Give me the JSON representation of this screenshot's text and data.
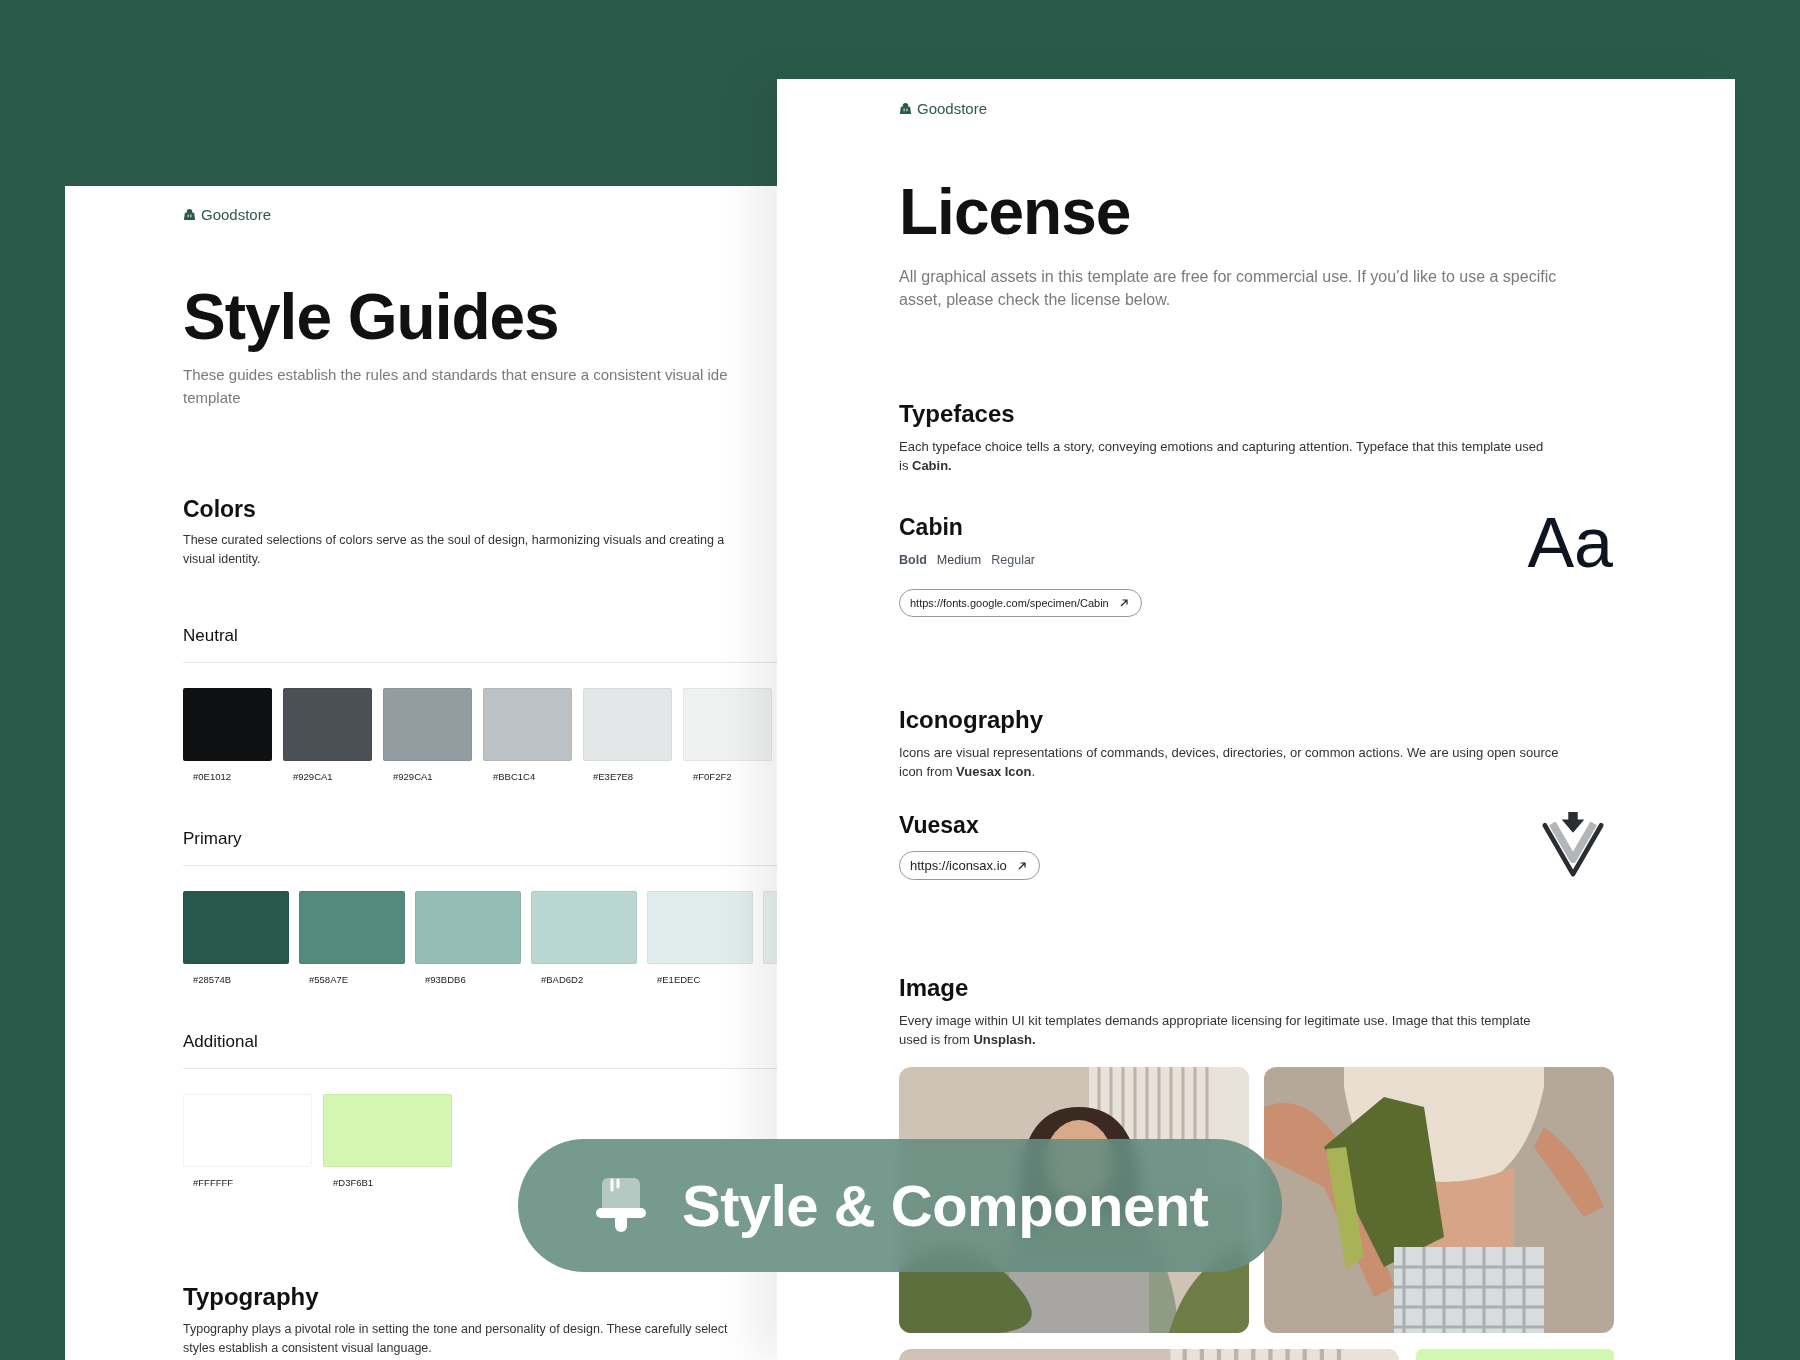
{
  "left_page": {
    "brand": "Goodstore",
    "title": "Style Guides",
    "intro_lines": [
      "These guides establish the rules and standards that ensure a consistent visual ide",
      "template"
    ],
    "colors": {
      "heading": "Colors",
      "lines": [
        "These curated selections of colors serve as the soul of design, harmonizing visuals and creating a",
        "visual identity."
      ],
      "groups": [
        {
          "title": "Neutral",
          "swatches": [
            {
              "color": "#0e1012",
              "label": "#0E1012"
            },
            {
              "color": "#4a5056",
              "label": "#929CA1"
            },
            {
              "color": "#929ca1",
              "label": "#929CA1"
            },
            {
              "color": "#bbc1c4",
              "label": "#BBC1C4"
            },
            {
              "color": "#e3e7e8",
              "label": "#E3E7E8"
            },
            {
              "color": "#f0f2f2",
              "label": "#F0F2F2"
            }
          ]
        },
        {
          "title": "Primary",
          "swatches": [
            {
              "color": "#28574b",
              "label": "#28574B"
            },
            {
              "color": "#558a7e",
              "label": "#558A7E"
            },
            {
              "color": "#93bdb6",
              "label": "#93BDB6"
            },
            {
              "color": "#bad6d2",
              "label": "#BAD6D2"
            },
            {
              "color": "#e1edec",
              "label": "#E1EDEC"
            },
            {
              "color": "#e9f2f0"
            }
          ]
        },
        {
          "title": "Additional",
          "swatches": [
            {
              "color": "#ffffff",
              "label": "#FFFFFF"
            },
            {
              "color": "#d3f6b1",
              "label": "#D3F6B1"
            }
          ]
        }
      ]
    },
    "typography": {
      "heading": "Typography",
      "lines": [
        "Typography plays a pivotal role in setting the tone and personality of design. These carefully select",
        "styles establish a consistent visual language."
      ]
    }
  },
  "right_page": {
    "brand": "Goodstore",
    "title": "License",
    "intro_lines": [
      "All graphical assets in this template are free for commercial use. If you’d like to use a specific",
      "asset, please check the license below."
    ],
    "sections": [
      {
        "heading": "Typefaces",
        "lines": [
          " Each typeface choice tells a story, conveying emotions and capturing attention. Typeface that this template used",
          "is **Cabin.**"
        ],
        "item": {
          "kind": "typeface",
          "name": "Cabin",
          "weights": [
            "Bold",
            "Medium",
            "Regular"
          ],
          "link": "https://fonts.google.com/specimen/Cabin",
          "sample": "Aa"
        }
      },
      {
        "heading": "Iconography",
        "lines": [
          "Icons are visual representations of commands, devices, directories, or common actions. We are using open source",
          "icon from **Vuesax Icon**."
        ],
        "item": {
          "kind": "iconset",
          "name": "Vuesax",
          "link": "https://iconsax.io"
        }
      },
      {
        "heading": "Image",
        "lines": [
          "Every image within UI kit templates demands appropriate licensing for legitimate use. Image that this template",
          "used is from **Unsplash.**"
        ],
        "images": [
          {
            "kind": "picture"
          },
          {
            "kind": "picture"
          },
          {
            "kind": "picture"
          },
          {
            "kind": "panel"
          }
        ]
      }
    ]
  },
  "banner": {
    "label": "Style & Component"
  }
}
